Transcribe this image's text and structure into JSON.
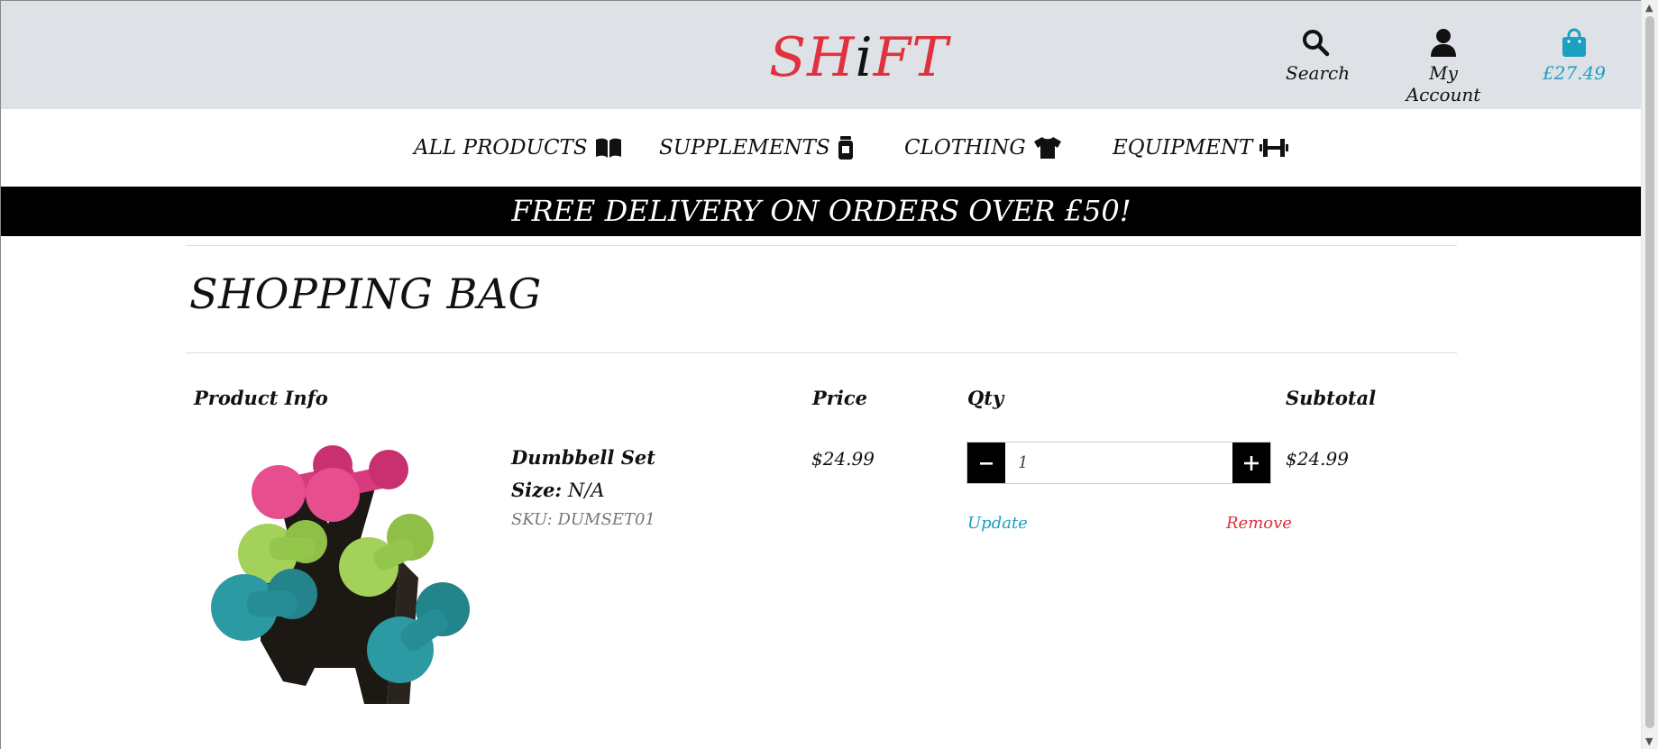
{
  "header": {
    "logo_left": "SH",
    "logo_dot": "i",
    "logo_right": "FT",
    "search_label": "Search",
    "account_label": "My Account",
    "bag_total": "£27.49",
    "icons": {
      "search": "search-icon",
      "account": "user-icon",
      "bag": "shopping-bag-icon"
    },
    "colors": {
      "brand": "#e0323e",
      "accent": "#1aa0c0",
      "bar": "#dee2e6"
    }
  },
  "nav": {
    "items": [
      {
        "label": "ALL PRODUCTS",
        "icon": "book-open-icon"
      },
      {
        "label": "SUPPLEMENTS",
        "icon": "supplement-jar-icon"
      },
      {
        "label": "CLOTHING",
        "icon": "tshirt-icon"
      },
      {
        "label": "EQUIPMENT",
        "icon": "dumbbell-icon"
      }
    ]
  },
  "banner": {
    "text": "FREE DELIVERY ON ORDERS OVER £50!"
  },
  "page": {
    "title": "SHOPPING BAG"
  },
  "table": {
    "headers": {
      "info": "Product Info",
      "price": "Price",
      "qty": "Qty",
      "subtotal": "Subtotal"
    },
    "items": [
      {
        "name": "Dumbbell Set",
        "size_label": "Size:",
        "size_value": "N/A",
        "sku": "SKU: DUMSET01",
        "price": "$24.99",
        "qty": "1",
        "subtotal": "$24.99",
        "update_label": "Update",
        "remove_label": "Remove"
      }
    ]
  }
}
